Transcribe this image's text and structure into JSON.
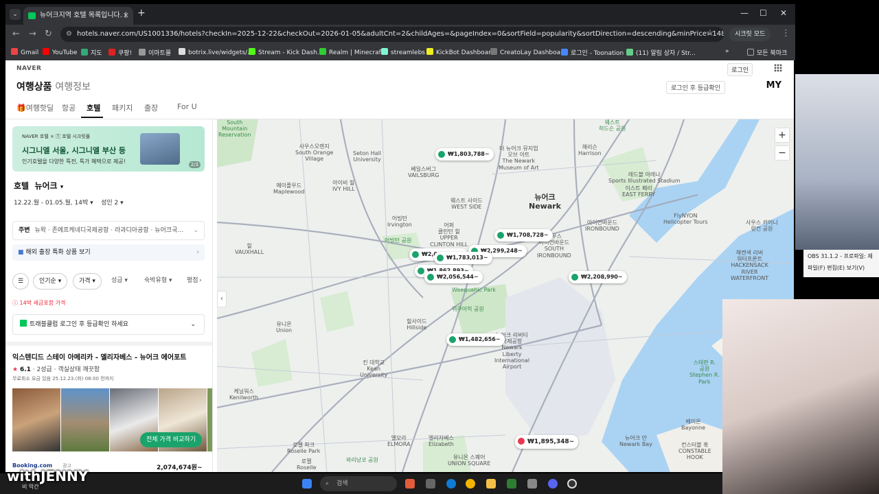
{
  "browser": {
    "tab_title": "뉴어크지역 호텔 목록입니다. (",
    "url": "hotels.naver.com/US1001336/hotels?checkIn=2025-12-22&checkOut=2026-01-05&adultCnt=2&childAges=&pageIndex=0&sortField=popularity&sortDirection=descending&minPrice=1482656&maxPrice=2135883",
    "secret_mode": "시크릿 모드",
    "bookmarks": [
      "Gmail",
      "YouTube",
      "지도",
      "쿠팡!",
      "이마트몰",
      "botrix.live/widgets/...",
      "Stream - Kick Dash...",
      "Realm | Minecraft",
      "streamlebs",
      "KickBot Dashboard",
      "CreatoLay Dashboa...",
      "로그인 - Toonation",
      "(11) 알림 상자 / Str..."
    ],
    "all_bookmarks": "모든 북마크"
  },
  "header": {
    "naver": "NAVER",
    "login": "로그인",
    "service_title": "여행상품",
    "service_sub": "여행정보",
    "grade_check": "로그인 후 등급확인",
    "my": "MY"
  },
  "categories": [
    "🎁여행핫딜",
    "항공",
    "호텔",
    "패키지",
    "출장",
    "For U"
  ],
  "sidebar": {
    "banner_top": "NAVER 호텔 × 🅃 호텔 시크릿몰",
    "banner_title": "시그니엘 서울, 시그니엘 부산 등",
    "banner_sub": "인기호텔을 다양한 특전, 특가 혜택으로 제공!",
    "banner_page": "2/3",
    "location_label": "호텔",
    "location_value": "뉴어크",
    "dates": "12.22.월 - 01.05.월, 14박",
    "guests": "성인 2",
    "nearby_label": "주변",
    "nearby_items": "뉴왁 · 존에프케네디국제공항 · 라과디아공항 · 뉴어크국...",
    "overseas": "해외 출장 특화 상품 보기",
    "filters": [
      "인기순",
      "가격",
      "성급",
      "숙박유형",
      "평점"
    ],
    "tax_note": "14박 세금포함 가격",
    "traveler_login": "트래블클럽 로그인 후 등급확인 하세요",
    "hotel_name": "익스텐디드 스테이 아메리카 - 엘리자베스 - 뉴어크 에어포트",
    "hotel_rating": "6.1",
    "hotel_grade": "2성급 · 객실상태 깨끗함",
    "hotel_cancel": "무료취소 요금 있음 25.12.23.(화) 08:00 전까지",
    "compare_btn": "전체 가격 비교하기",
    "provider": "Booking.com",
    "ad": "광고",
    "price": "2,074,674원~"
  },
  "map": {
    "labels": [
      {
        "text": "South\nMountain\nReservation",
        "cls": "green"
      },
      {
        "text": "사우스오렌지\nSouth Orange\nVillage",
        "cls": ""
      },
      {
        "text": "Seton Hall\nUniversity",
        "cls": ""
      },
      {
        "text": "메이플우드\nMaplewood",
        "cls": ""
      },
      {
        "text": "아이비 힐\nIVY HILL",
        "cls": ""
      },
      {
        "text": "베일스버그\nVAILSBURG",
        "cls": ""
      },
      {
        "text": "더 뉴어크 뮤지엄\n오브 아트\nThe Newark\nMuseum of Art",
        "cls": ""
      },
      {
        "text": "웨스트\n허드슨 공원",
        "cls": "green"
      },
      {
        "text": "해리슨\nHarrison",
        "cls": ""
      },
      {
        "text": "레드블 아레나\nSports Illustrated Stadium",
        "cls": ""
      },
      {
        "text": "이스트 페리\nEAST FERRY",
        "cls": ""
      },
      {
        "text": "웨스트 사이드\nWEST SIDE",
        "cls": ""
      },
      {
        "text": "뉴어크\nNewark",
        "cls": "big"
      },
      {
        "text": "어빙턴\nIrvington",
        "cls": ""
      },
      {
        "text": "어퍼\n클린턴 힐\nUPPER\nCLINTON HILL",
        "cls": ""
      },
      {
        "text": "어빙턴 공원",
        "cls": "green"
      },
      {
        "text": "사우스\n아이언바운드\nSOUTH\nIRONBOUND",
        "cls": ""
      },
      {
        "text": "아이언바운드\nIRONBOUND",
        "cls": ""
      },
      {
        "text": "FlyNYON\nHelicopter Tours",
        "cls": ""
      },
      {
        "text": "힐\nVAUXHALL",
        "cls": ""
      },
      {
        "text": "Weequahic Park",
        "cls": "green"
      },
      {
        "text": "위쿠아힉 공원",
        "cls": "green"
      },
      {
        "text": "유니온\nUnion",
        "cls": ""
      },
      {
        "text": "힐사이드\nHillside",
        "cls": ""
      },
      {
        "text": "뉴어크 리버티\n국제공항\nNewark\nLiberty\nInternational\nAirport",
        "cls": ""
      },
      {
        "text": "킨 대학교\nKean\nUniversity",
        "cls": ""
      },
      {
        "text": "케닐워스\nKenilworth",
        "cls": ""
      },
      {
        "text": "로젤 파크\nRoselle Park",
        "cls": ""
      },
      {
        "text": "엘리자베스\nElizabeth",
        "cls": ""
      },
      {
        "text": "유니온 스퀘어\nUNION SQUARE",
        "cls": ""
      },
      {
        "text": "와리낭코 공원",
        "cls": "green"
      },
      {
        "text": "로젤\nRoselle",
        "cls": ""
      },
      {
        "text": "엘모라\nELMORA",
        "cls": ""
      },
      {
        "text": "베이온\nBayonne",
        "cls": ""
      },
      {
        "text": "뉴어크 만\nNewark Bay",
        "cls": ""
      },
      {
        "text": "스테판 R.\n공원\nStephen R.\nPark",
        "cls": "green"
      },
      {
        "text": "컨스터블 훅\nCONSTABLE\nHOOK",
        "cls": ""
      },
      {
        "text": "사우스 키어니\n링컨 공원",
        "cls": ""
      },
      {
        "text": "해켄색 리버\n워터프론트\nHACKENSACK\nRIVER\nWATERFRONT",
        "cls": ""
      }
    ],
    "pins": [
      {
        "price": "₩1,803,788~",
        "red": false
      },
      {
        "price": "₩1,708,728~",
        "red": false
      },
      {
        "price": "₩2,299,248~",
        "red": false
      },
      {
        "price": "₩2,003,666~",
        "red": false
      },
      {
        "price": "₩1,783,013~",
        "red": false
      },
      {
        "price": "₩1,862,893~",
        "red": false
      },
      {
        "price": "₩2,056,544~",
        "red": false
      },
      {
        "price": "₩2,208,990~",
        "red": false
      },
      {
        "price": "₩1,482,656~",
        "red": false
      },
      {
        "price": "₩1,895,348~",
        "red": true
      }
    ],
    "zoom_in": "+",
    "zoom_out": "−"
  },
  "overlays": {
    "obs_title": "OBS 31.1.2 - 프로파일: 제",
    "obs_menu": "파일(F)   편집(E)   보기(V)",
    "watermark": "withJENNY",
    "watermark_sub": "비 악간",
    "taskbar_search": "검색"
  },
  "colors": {
    "accent": "#03c75a",
    "pin_green": "#1aa36b",
    "pin_red": "#e8384f"
  }
}
